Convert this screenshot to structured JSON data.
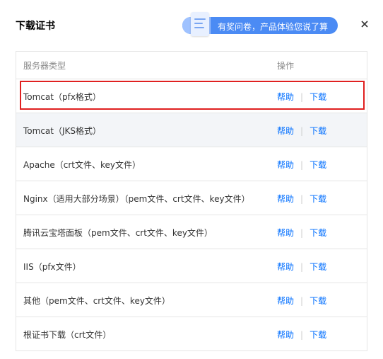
{
  "dialog": {
    "title": "下载证书",
    "survey_text": "有奖问卷，产品体验您说了算"
  },
  "table": {
    "headers": [
      "服务器类型",
      "操作"
    ],
    "rows": [
      {
        "name": "Tomcat（pfx格式）",
        "help": "帮助",
        "download": "下载"
      },
      {
        "name": "Tomcat（JKS格式）",
        "help": "帮助",
        "download": "下载"
      },
      {
        "name": "Apache（crt文件、key文件）",
        "help": "帮助",
        "download": "下载"
      },
      {
        "name": "Nginx（适用大部分场景）（pem文件、crt文件、key文件）",
        "help": "帮助",
        "download": "下载"
      },
      {
        "name": "腾讯云宝塔面板（pem文件、crt文件、key文件）",
        "help": "帮助",
        "download": "下载"
      },
      {
        "name": "IIS（pfx文件）",
        "help": "帮助",
        "download": "下载"
      },
      {
        "name": "其他（pem文件、crt文件、key文件）",
        "help": "帮助",
        "download": "下载"
      },
      {
        "name": "根证书下载（crt文件）",
        "help": "帮助",
        "download": "下载"
      }
    ]
  },
  "separator": "|",
  "colors": {
    "link": "#006eff",
    "highlight": "#e02020",
    "survey_bg": "#4b8bf4"
  },
  "icons": {
    "close": "close-icon",
    "survey": "document-icon"
  }
}
